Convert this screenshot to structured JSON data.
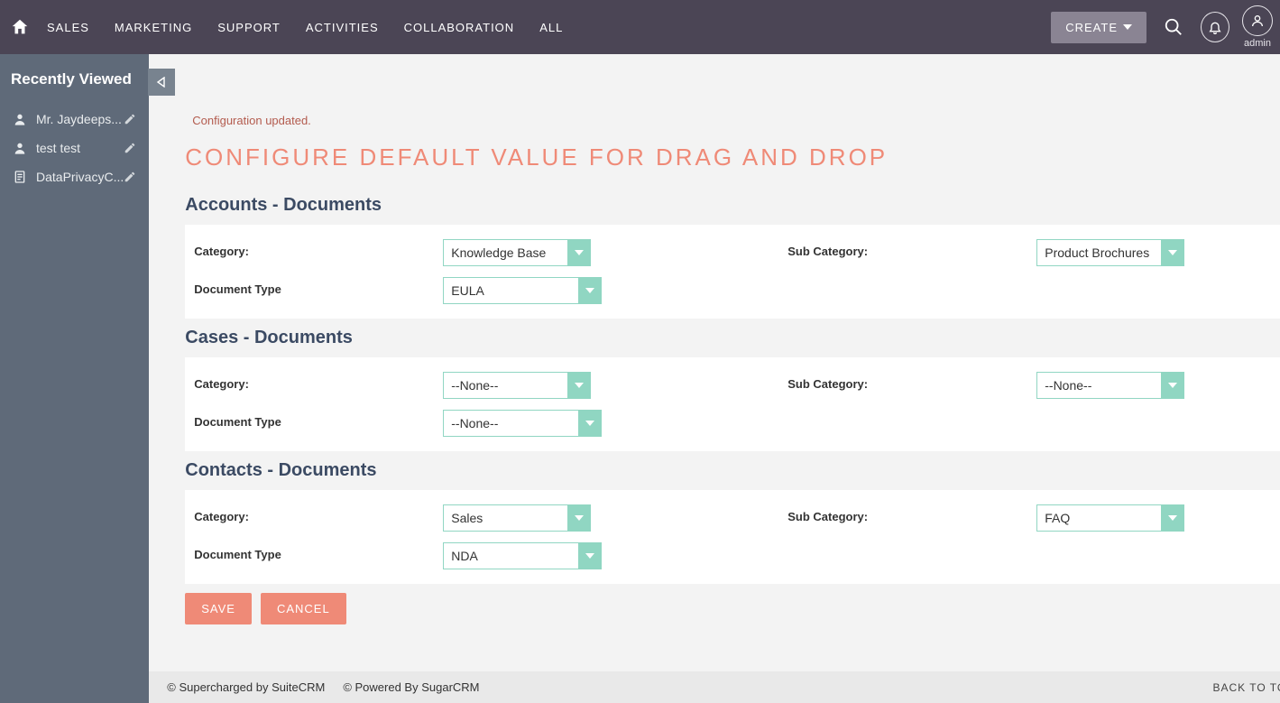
{
  "nav": {
    "items": [
      "SALES",
      "MARKETING",
      "SUPPORT",
      "ACTIVITIES",
      "COLLABORATION",
      "ALL"
    ],
    "create_label": "CREATE",
    "user_label": "admin"
  },
  "sidebar": {
    "heading": "Recently Viewed",
    "items": [
      {
        "icon": "person",
        "label": "Mr. Jaydeeps..."
      },
      {
        "icon": "person",
        "label": "test test"
      },
      {
        "icon": "document",
        "label": "DataPrivacyC..."
      }
    ]
  },
  "status_message": "Configuration updated.",
  "page_title": "CONFIGURE DEFAULT VALUE FOR DRAG AND DROP",
  "labels": {
    "category": "Category:",
    "sub_category": "Sub Category:",
    "document_type": "Document Type"
  },
  "sections": [
    {
      "title": "Accounts - Documents",
      "category": "Knowledge Base",
      "sub_category": "Product Brochures",
      "document_type": "EULA"
    },
    {
      "title": "Cases - Documents",
      "category": "--None--",
      "sub_category": "--None--",
      "document_type": "--None--"
    },
    {
      "title": "Contacts - Documents",
      "category": "Sales",
      "sub_category": "FAQ",
      "document_type": "NDA"
    }
  ],
  "buttons": {
    "save": "SAVE",
    "cancel": "CANCEL"
  },
  "footer": {
    "left1": "© Supercharged by SuiteCRM",
    "left2": "© Powered By SugarCRM",
    "back_to_top": "BACK TO TOP"
  }
}
